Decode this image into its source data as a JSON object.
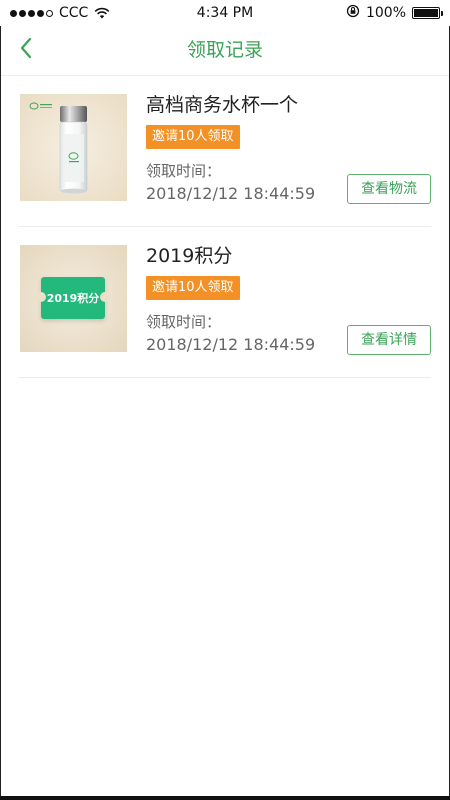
{
  "status_bar": {
    "carrier": "CCC",
    "time": "4:34 PM",
    "battery": "100%",
    "signal_bars": 4,
    "signal_total": 5
  },
  "nav": {
    "title": "领取记录",
    "back_icon": "chevron-left-icon"
  },
  "colors": {
    "accent": "#3aa357",
    "tag": "#f39126"
  },
  "records": [
    {
      "title": "高档商务水杯一个",
      "tag": "邀请10人领取",
      "time_label": "领取时间：",
      "time": "2018/12/12 18:44:59",
      "action": "查看物流",
      "image": "glass-cup-image"
    },
    {
      "title": "2019积分",
      "tag": "邀请10人领取",
      "time_label": "领取时间：",
      "time": "2018/12/12 18:44:59",
      "action": "查看详情",
      "image": "points-ticket-image",
      "image_text": "2019积分"
    }
  ]
}
